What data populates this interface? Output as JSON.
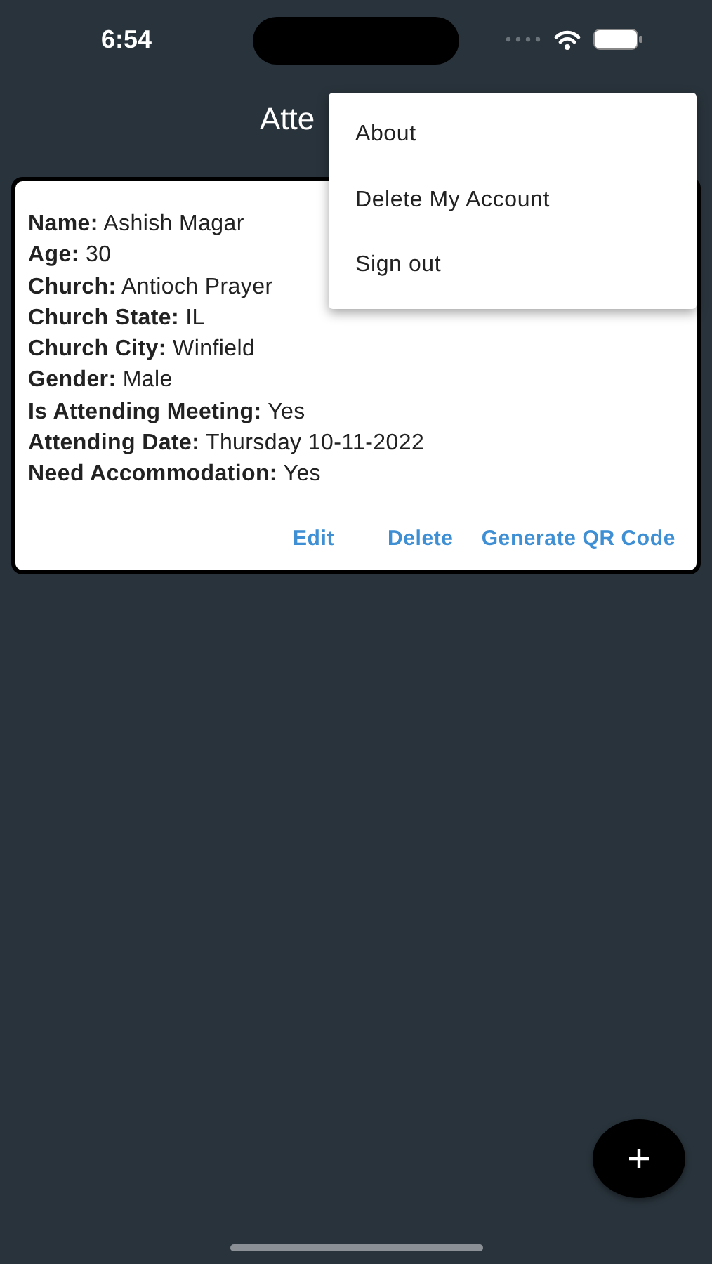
{
  "status_bar": {
    "time": "6:54"
  },
  "app_bar": {
    "title": "Atte"
  },
  "card": {
    "fields": [
      {
        "label": "Name:",
        "value": "Ashish Magar"
      },
      {
        "label": "Age:",
        "value": "30"
      },
      {
        "label": "Church:",
        "value": "Antioch Prayer"
      },
      {
        "label": "Church State:",
        "value": "IL"
      },
      {
        "label": "Church City:",
        "value": "Winfield"
      },
      {
        "label": "Gender:",
        "value": "Male"
      },
      {
        "label": "Is Attending Meeting:",
        "value": "Yes"
      },
      {
        "label": "Attending Date:",
        "value": "Thursday 10-11-2022"
      },
      {
        "label": "Need Accommodation:",
        "value": "Yes"
      }
    ],
    "actions": [
      "Edit",
      "Delete",
      "Generate QR Code"
    ]
  },
  "menu": {
    "items": [
      "About",
      "Delete My Account",
      "Sign out"
    ]
  },
  "fab": {
    "kind": "add"
  }
}
